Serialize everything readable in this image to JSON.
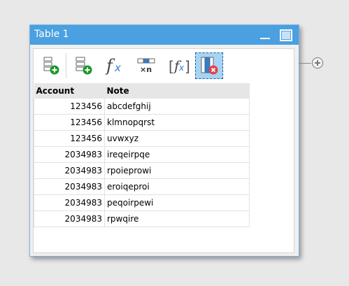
{
  "window": {
    "title": "Table 1"
  },
  "toolbar": {
    "buttons": [
      {
        "name": "add-row-button",
        "icon": "add-row-icon"
      },
      {
        "name": "add-column-button",
        "icon": "add-column-icon"
      },
      {
        "name": "formula-button",
        "icon": "fx-icon"
      },
      {
        "name": "multiply-n-button",
        "icon": "multiply-n-icon",
        "label": "×n"
      },
      {
        "name": "bracket-formula-button",
        "icon": "bracket-fx-icon"
      },
      {
        "name": "delete-column-button",
        "icon": "delete-column-icon",
        "active": true
      }
    ]
  },
  "table": {
    "headers": [
      "Account",
      "Note"
    ],
    "rows": [
      [
        "123456",
        "abcdefghij"
      ],
      [
        "123456",
        "klmnopqrst"
      ],
      [
        "123456",
        "uvwxyz"
      ],
      [
        "2034983",
        "ireqeirpqe"
      ],
      [
        "2034983",
        "rpoieprowi"
      ],
      [
        "2034983",
        "eroiqeproi"
      ],
      [
        "2034983",
        "peqoirpewi"
      ],
      [
        "2034983",
        "rpwqire"
      ]
    ]
  },
  "colors": {
    "titlebar": "#4aa0e0",
    "active_button": "#a6d4f6",
    "icon_green": "#1a9a2a",
    "icon_blue": "#2b7fd4",
    "icon_red": "#e0434b"
  }
}
